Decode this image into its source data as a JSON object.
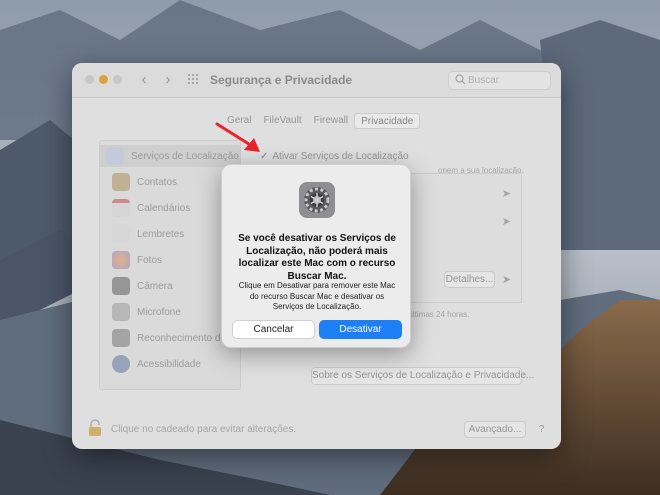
{
  "window": {
    "title": "Segurança e Privacidade",
    "search_placeholder": "Buscar"
  },
  "tabs": [
    {
      "label": "Geral",
      "active": false
    },
    {
      "label": "FileVault",
      "active": false
    },
    {
      "label": "Firewall",
      "active": false
    },
    {
      "label": "Privacidade",
      "active": true
    }
  ],
  "sidebar": {
    "items": [
      {
        "label": "Serviços de Localização",
        "icon": "location-icon",
        "color": "#c9d3e0",
        "selected": true
      },
      {
        "label": "Contatos",
        "icon": "contacts-icon",
        "color": "#c8b59a"
      },
      {
        "label": "Calendários",
        "icon": "calendar-icon",
        "color": "#dedede"
      },
      {
        "label": "Lembretes",
        "icon": "reminders-icon",
        "color": "#e0e0e0"
      },
      {
        "label": "Fotos",
        "icon": "photos-icon",
        "color": "#d9c9b9"
      },
      {
        "label": "Câmera",
        "icon": "camera-icon",
        "color": "#9a9a9a"
      },
      {
        "label": "Microfone",
        "icon": "microphone-icon",
        "color": "#bdbdbd"
      },
      {
        "label": "Reconhecimento de Fala",
        "icon": "speech-icon",
        "color": "#a9a9a9"
      },
      {
        "label": "Acessibilidade",
        "icon": "accessibility-icon",
        "color": "#9aa8be"
      }
    ]
  },
  "location": {
    "enable_label": "Ativar Serviços de Localização",
    "hint_right": "onem a sua localização.",
    "hint_bottom": "ização nas últimas 24 horas.",
    "detalhes_label": "Detalhes...",
    "about_label": "Sobre os Serviços de Localização e Privacidade..."
  },
  "footer": {
    "lock_text": "Clique no cadeado para evitar alterações.",
    "advanced_label": "Avançado...",
    "help_label": "?"
  },
  "dialog": {
    "title": "Se você desativar os Serviços de Localização, não poderá mais localizar este Mac com o recurso Buscar Mac.",
    "message": "Clique em Desativar para remover este Mac do recurso Buscar Mac e desativar os Serviços de Localização.",
    "cancel_label": "Cancelar",
    "confirm_label": "Desativar",
    "accent": "#1d7ff5"
  },
  "colors": {
    "annotation_arrow": "#e8242c"
  }
}
